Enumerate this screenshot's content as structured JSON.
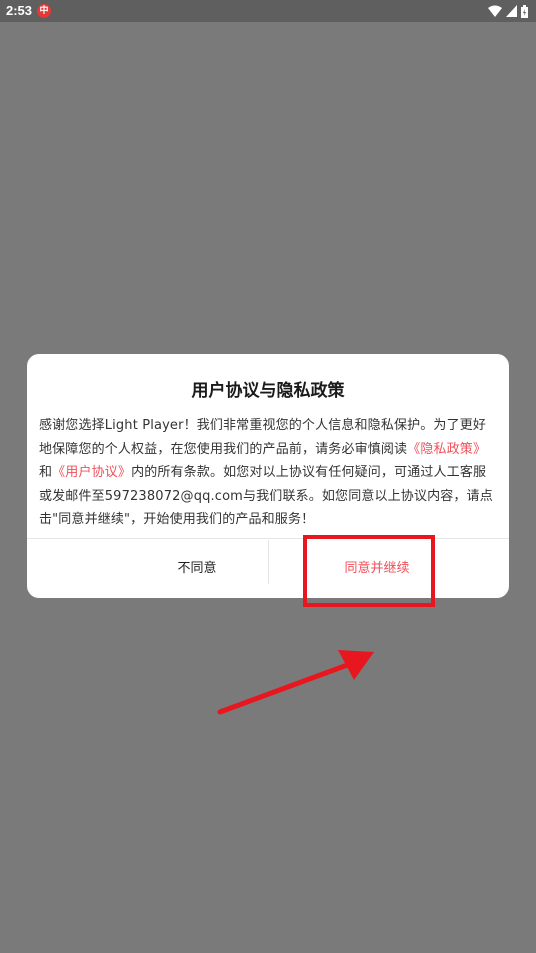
{
  "status_bar": {
    "time": "2:53",
    "notification_icon": "notification-app-icon",
    "icons": [
      "wifi-icon",
      "cell-signal-icon",
      "battery-icon"
    ]
  },
  "dialog": {
    "title": "用户协议与隐私政策",
    "body": {
      "intro": "感谢您选择Light Player！我们非常重视您的个人信息和隐私保护。为了更好地保障您的个人权益，在您使用我们的产品前，请务必审慎阅读",
      "privacy_link": "《隐私政策》",
      "and": "和",
      "agreement_link": "《用户协议》",
      "outro": "内的所有条款。如您对以上协议有任何疑问，可通过人工客服或发邮件至597238072@qq.com与我们联系。如您同意以上协议内容，请点击\"同意并继续\"，开始使用我们的产品和服务！"
    },
    "disagree_label": "不同意",
    "agree_label": "同意并继续"
  },
  "colors": {
    "overlay": "#7a7a7a",
    "accent": "#f0505a",
    "annotation": "#e8161f"
  }
}
